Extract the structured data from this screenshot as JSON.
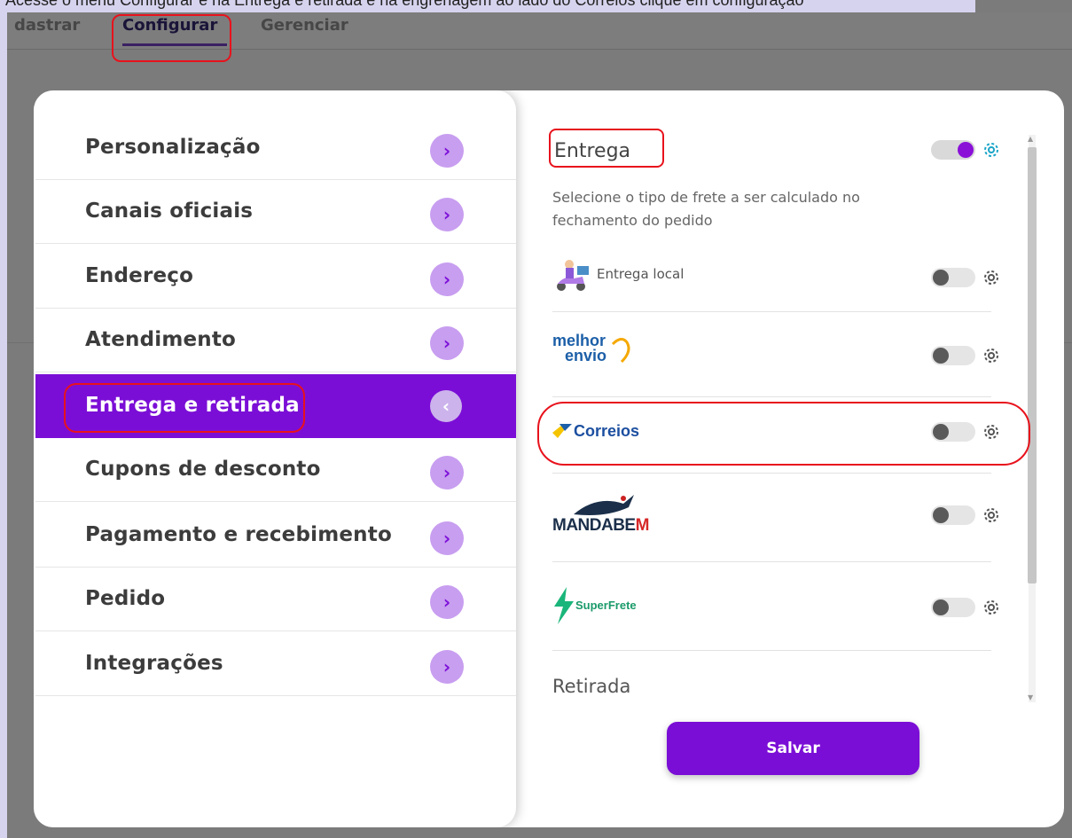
{
  "banner": {
    "text": "Acesse o menu Configurar e na Entrega e retirada e na engrenagem ao lado do Correios clique em configuração"
  },
  "topnav": {
    "tabs": [
      "dastrar",
      "Configurar",
      "Gerenciar"
    ]
  },
  "sidebar": {
    "items": [
      {
        "label": "Personalização",
        "arrow": "›"
      },
      {
        "label": "Canais oficiais",
        "arrow": "›"
      },
      {
        "label": "Endereço",
        "arrow": "›"
      },
      {
        "label": "Atendimento",
        "arrow": "›"
      },
      {
        "label": "Entrega e retirada",
        "arrow": "‹",
        "active": true
      },
      {
        "label": "Cupons de desconto",
        "arrow": "›"
      },
      {
        "label": "Pagamento e recebimento",
        "arrow": "›"
      },
      {
        "label": "Pedido",
        "arrow": "›"
      },
      {
        "label": "Integrações",
        "arrow": "›"
      }
    ]
  },
  "delivery": {
    "title": "Entrega",
    "enabled": true,
    "description": "Selecione o tipo de frete a ser calculado no fechamento do pedido",
    "providers": [
      {
        "name": "Entrega local",
        "logo": "delivery-scooter-icon",
        "enabled": false
      },
      {
        "name": "melhor envio",
        "logo_line1": "melhor",
        "logo_line2": "envio",
        "enabled": false
      },
      {
        "name": "Correios",
        "enabled": false
      },
      {
        "name": "MANDABEM",
        "logo_a": "MANDABE",
        "logo_b": "M",
        "enabled": false
      },
      {
        "name": "SuperFrete",
        "enabled": false
      }
    ]
  },
  "pickup": {
    "title": "Retirada"
  },
  "actions": {
    "save_label": "Salvar"
  },
  "colors": {
    "brand": "#7b0ed6",
    "arrow_bg": "#c89ef0",
    "highlight": "#e8121c",
    "gear_active": "#1aa4c8"
  }
}
